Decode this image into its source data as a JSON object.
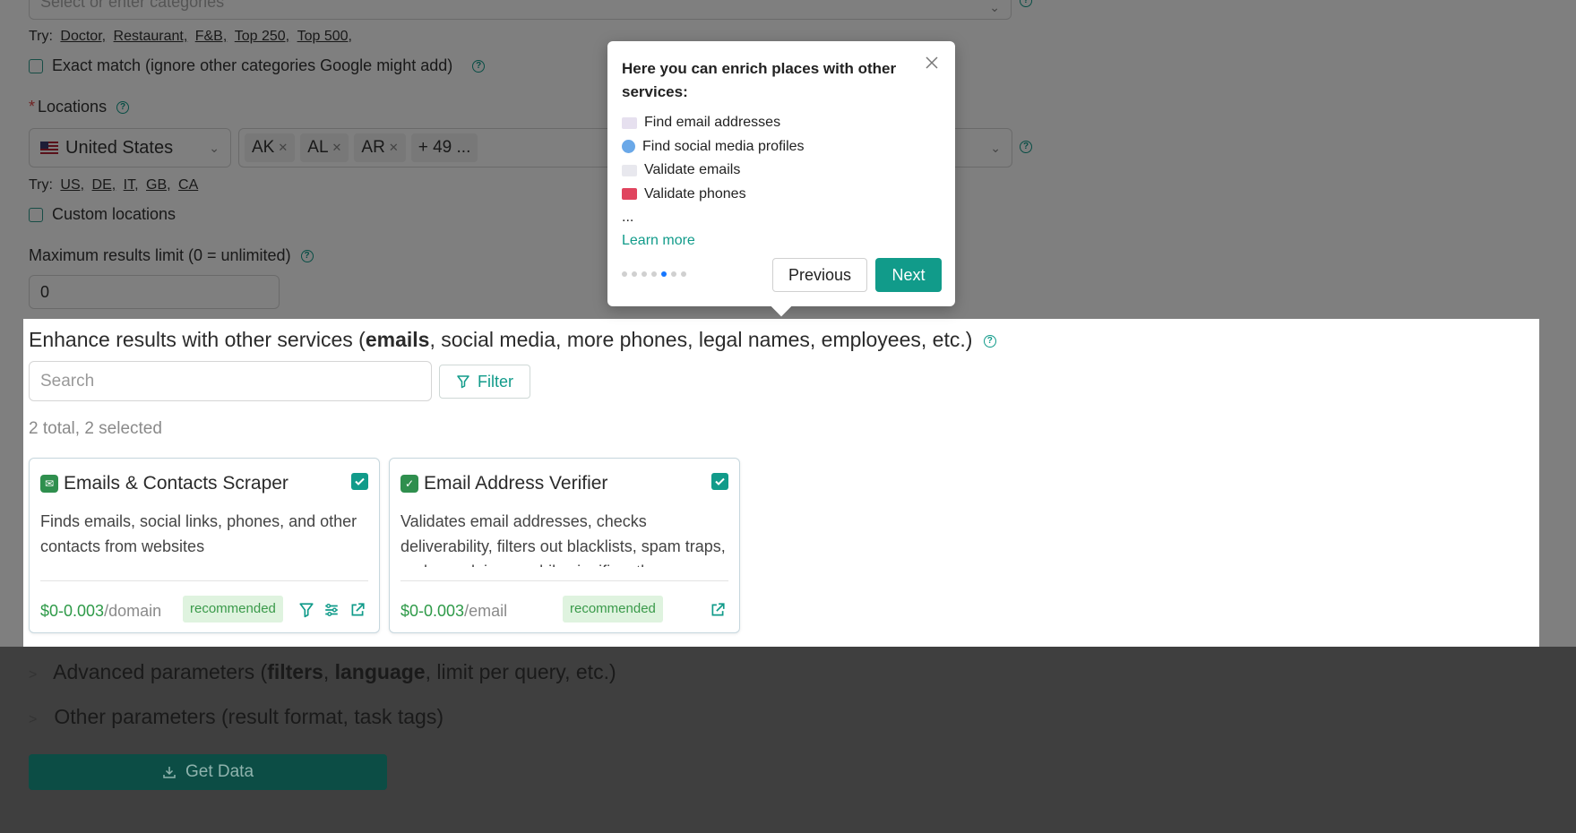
{
  "categories": {
    "placeholder": "Select or enter categories",
    "try_label": "Try:",
    "try_links": [
      "Doctor,",
      "Restaurant,",
      "F&B,",
      "Top 250,",
      "Top 500,"
    ],
    "exact_match_label": "Exact match (ignore other categories Google might add)"
  },
  "locations": {
    "label": "Locations",
    "country": "United States",
    "tags": [
      "AK",
      "AL",
      "AR"
    ],
    "more_tag": "+ 49 ...",
    "try_label": "Try:",
    "try_links": [
      "US,",
      "DE,",
      "IT,",
      "GB,",
      "CA"
    ],
    "custom_label": "Custom locations"
  },
  "max_results": {
    "label": "Maximum results limit (0 = unlimited)",
    "value": "0"
  },
  "enhance": {
    "title_pre": "Enhance results with other services (",
    "title_bold": "emails",
    "title_post": ", social media, more phones, legal names, employees, etc.)",
    "search_placeholder": "Search",
    "filter_label": "Filter",
    "total_text": "2 total, 2 selected",
    "cards": [
      {
        "title": "Emails & Contacts Scraper",
        "description": "Finds emails, social links, phones, and other contacts from websites",
        "price": "$0-0.003",
        "unit": "/domain",
        "badge": "recommended"
      },
      {
        "title": "Email Address Verifier",
        "description": "Validates email addresses, checks deliverability, filters out blacklists, spam traps, and complainers, while significantly",
        "price": "$0-0.003",
        "unit": "/email",
        "badge": "recommended"
      }
    ]
  },
  "advanced": {
    "pre": "Advanced parameters (",
    "bold1": "filters",
    "sep": ", ",
    "bold2": "language",
    "post": ", limit per query, etc.)"
  },
  "other": {
    "label": "Other parameters (result format, task tags)"
  },
  "get_data": {
    "label": "Get Data"
  },
  "popover": {
    "title": "Here you can enrich places with other services:",
    "items": [
      {
        "text": "Find email addresses",
        "icon": "envelope-icon",
        "color": "#e6e0ef"
      },
      {
        "text": "Find social media profiles",
        "icon": "globe-icon",
        "color": "#6aa8e8"
      },
      {
        "text": "Validate emails",
        "icon": "envelope-check-icon",
        "color": "#e8e8ee"
      },
      {
        "text": "Validate phones",
        "icon": "telephone-icon",
        "color": "#e0445e"
      }
    ],
    "ellipsis": "...",
    "learn_more": "Learn more",
    "previous": "Previous",
    "next": "Next",
    "steps_total": 7,
    "step_active": 5
  },
  "colors": {
    "accent": "#119b8a",
    "price": "#2e9a48"
  }
}
